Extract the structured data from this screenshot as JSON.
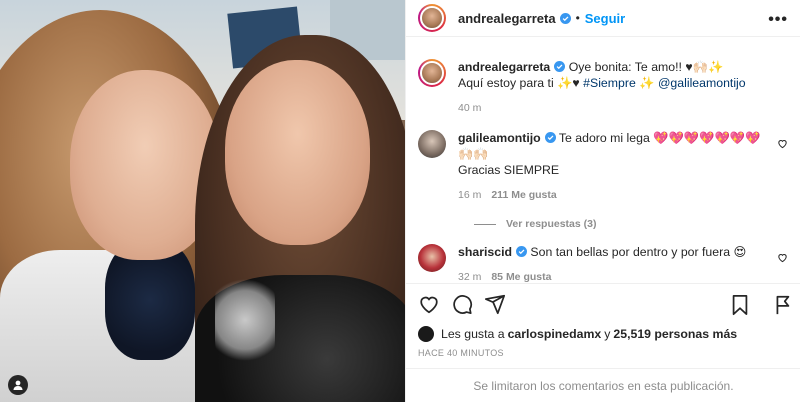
{
  "post": {
    "author": "andrealegarreta",
    "follow_label": "Seguir",
    "dot": "•",
    "more_label": "•••"
  },
  "caption": {
    "user": "andrealegarreta",
    "text_part1": "Oye bonita: Te amo!! ♥🙌🏻✨",
    "text_part2": "Aquí estoy para ti ✨♥ ",
    "hashtag": "#Siempre",
    "sparkle": " ✨ ",
    "mention": "@galileamontijo",
    "time": "40 m"
  },
  "comments": [
    {
      "user": "galileamontijo",
      "text": "Te adoro mi lega 💖💖💖💖💖💖💖🙌🏻🙌🏻",
      "text2": "Gracias SIEMPRE",
      "time": "16 m",
      "likes": "211 Me gusta",
      "replies": "Ver respuestas (3)"
    },
    {
      "user": "shariscid",
      "text": "Son tan bellas por dentro y por fuera 😍",
      "time": "32 m",
      "likes": "85 Me gusta"
    }
  ],
  "likes_line": {
    "prefix": "Les gusta a ",
    "user": "carlospinedamx",
    "middle": " y ",
    "count": "25,519 personas más"
  },
  "timestamp": "HACE 40 MINUTOS",
  "comments_disabled": "Se limitaron los comentarios en esta publicación.",
  "colors": {
    "follow": "#0095f6",
    "verified": "#3897f0",
    "link": "#00376b",
    "muted": "#8e8e8e"
  }
}
